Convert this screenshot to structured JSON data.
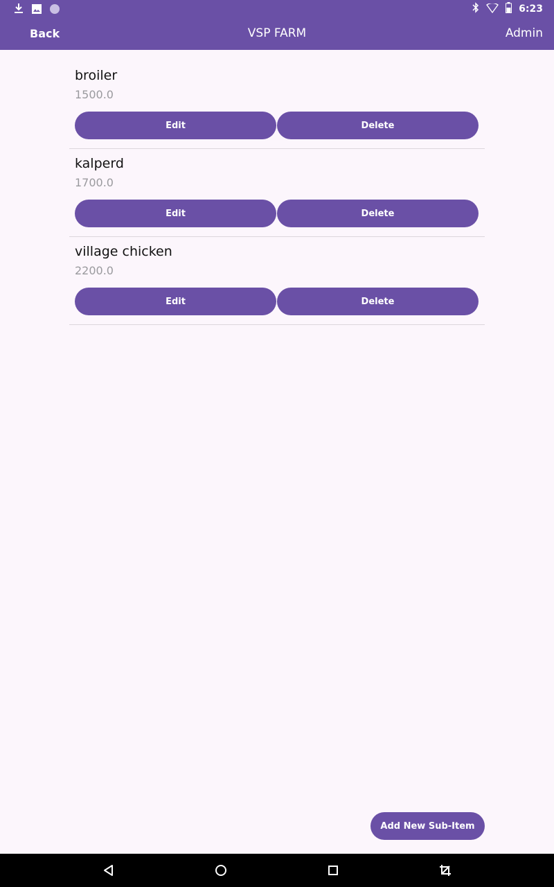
{
  "status_bar": {
    "time": "6:23",
    "icons_left": [
      "download-icon",
      "image-icon",
      "circle-icon"
    ],
    "icons_right": [
      "bluetooth-icon",
      "wifi-icon",
      "battery-icon"
    ]
  },
  "app_bar": {
    "back_label": "Back",
    "title": "VSP FARM",
    "admin_label": "Admin"
  },
  "items": [
    {
      "name": "broiler",
      "price": "1500.0",
      "edit_label": "Edit",
      "delete_label": "Delete"
    },
    {
      "name": "kalperd",
      "price": "1700.0",
      "edit_label": "Edit",
      "delete_label": "Delete"
    },
    {
      "name": "village chicken",
      "price": "2200.0",
      "edit_label": "Edit",
      "delete_label": "Delete"
    }
  ],
  "add_button_label": "Add New Sub-Item",
  "nav_bar": {
    "icons": [
      "back-icon",
      "home-icon",
      "recents-icon",
      "screenshot-icon"
    ]
  },
  "colors": {
    "accent": "#6a50a6",
    "background": "#fcf6fc"
  }
}
